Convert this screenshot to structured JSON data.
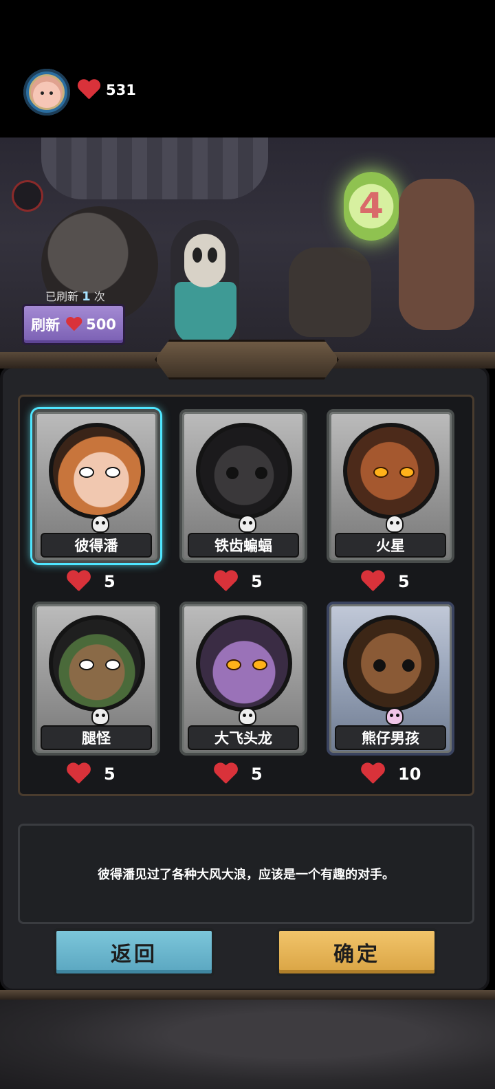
{
  "player": {
    "lives": "531",
    "avatar_icon": "player-avatar"
  },
  "scene": {
    "sign_number": "4"
  },
  "refresh": {
    "count_prefix": "已刷新",
    "count": "1",
    "count_suffix": "次",
    "button_label": "刷新",
    "cost": "500"
  },
  "opponents": [
    {
      "name": "彼得潘",
      "cost": "5",
      "selected": true
    },
    {
      "name": "铁齿蝙蝠",
      "cost": "5"
    },
    {
      "name": "火星",
      "cost": "5"
    },
    {
      "name": "腿怪",
      "cost": "5"
    },
    {
      "name": "大飞头龙",
      "cost": "5"
    },
    {
      "name": "熊仔男孩",
      "cost": "10"
    }
  ],
  "description": "彼得潘见过了各种大风大浪，应该是一个有趣的对手。",
  "buttons": {
    "back": "返回",
    "confirm": "确定"
  },
  "colors": {
    "selected_glow": "#4fe6ff",
    "heart": "#d9323a",
    "refresh_button": "#8f73c6",
    "back_button": "#6cb8d0",
    "confirm_button": "#e8b558"
  }
}
